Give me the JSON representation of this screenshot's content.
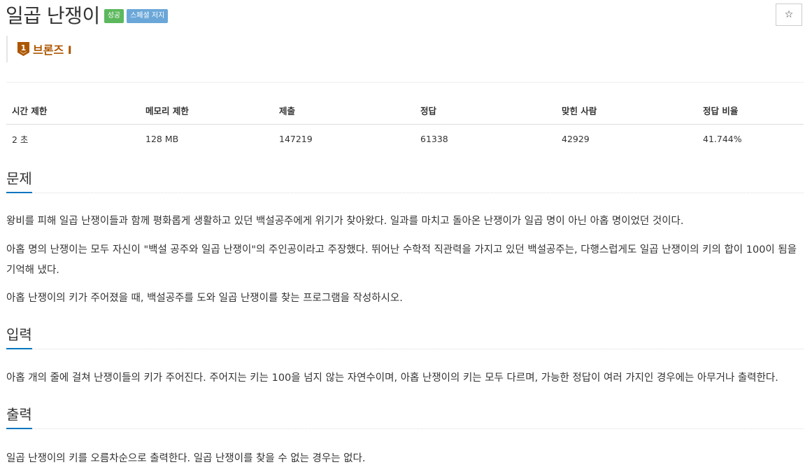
{
  "problem": {
    "title": "일곱 난쟁이",
    "badges": [
      "성공",
      "스페셜 저지"
    ],
    "star_icon": "☆",
    "tier": {
      "text": "브론즈 I",
      "level": "1",
      "color": "#ad5600"
    }
  },
  "stats": {
    "headers": [
      "시간 제한",
      "메모리 제한",
      "제출",
      "정답",
      "맞힌 사람",
      "정답 비율"
    ],
    "values": [
      "2 초",
      "128 MB",
      "147219",
      "61338",
      "42929",
      "41.744%"
    ]
  },
  "sections": {
    "description": {
      "heading": "문제",
      "paragraphs": [
        "왕비를 피해 일곱 난쟁이들과 함께 평화롭게 생활하고 있던 백설공주에게 위기가 찾아왔다. 일과를 마치고 돌아온 난쟁이가 일곱 명이 아닌 아홉 명이었던 것이다.",
        "아홉 명의 난쟁이는 모두 자신이 \"백설 공주와 일곱 난쟁이\"의 주인공이라고 주장했다. 뛰어난 수학적 직관력을 가지고 있던 백설공주는, 다행스럽게도 일곱 난쟁이의 키의 합이 100이 됨을 기억해 냈다.",
        "아홉 난쟁이의 키가 주어졌을 때, 백설공주를 도와 일곱 난쟁이를 찾는 프로그램을 작성하시오."
      ]
    },
    "input": {
      "heading": "입력",
      "paragraphs": [
        "아홉 개의 줄에 걸쳐 난쟁이들의 키가 주어진다. 주어지는 키는 100을 넘지 않는 자연수이며, 아홉 난쟁이의 키는 모두 다르며, 가능한 정답이 여러 가지인 경우에는 아무거나 출력한다."
      ]
    },
    "output": {
      "heading": "출력",
      "paragraphs": [
        "일곱 난쟁이의 키를 오름차순으로 출력한다. 일곱 난쟁이를 찾을 수 없는 경우는 없다."
      ]
    }
  },
  "colors": {
    "accent": "#0076c0",
    "success": "#5cb85c",
    "info": "#6aa7d8",
    "bronze": "#ad5600"
  }
}
